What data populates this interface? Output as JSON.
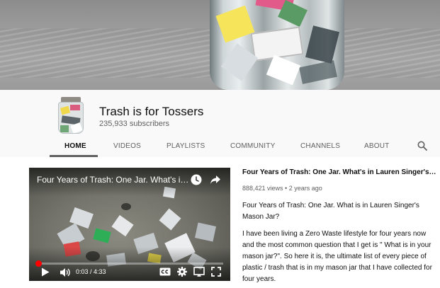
{
  "channel": {
    "name": "Trash is for Tossers",
    "subscribers": "235,933 subscribers"
  },
  "tabs": [
    {
      "label": "HOME",
      "active": true
    },
    {
      "label": "VIDEOS",
      "active": false
    },
    {
      "label": "PLAYLISTS",
      "active": false
    },
    {
      "label": "COMMUNITY",
      "active": false
    },
    {
      "label": "CHANNELS",
      "active": false
    },
    {
      "label": "ABOUT",
      "active": false
    }
  ],
  "player": {
    "title": "Four Years of Trash: One Jar. What's in Lauren Singer's Mason Jar?",
    "time": "0:03 / 4:33",
    "progress_fraction": 0.011
  },
  "video": {
    "title": "Four Years of Trash: One Jar. What's in Lauren Singer's Mason Jar?",
    "meta": "888,421 views • 2 years ago",
    "description": [
      "Four Years of Trash: One Jar. What is in Lauren Singer's Mason Jar?",
      "I have been living a Zero Waste lifestyle for four years now and the most common question that I get is \" What is in your mason jar?\". So here it is, the ultimate list of every piece of plastic / trash that is in my mason jar that I have collected for four years."
    ]
  },
  "icons": [
    "clock-icon",
    "share-icon",
    "play-icon",
    "volume-icon",
    "cc-icon",
    "settings-icon",
    "miniplayer-icon",
    "fullscreen-icon",
    "search-icon"
  ],
  "colors": {
    "accent": "#ff0000",
    "text_primary": "#0f0f0f",
    "text_secondary": "#606060",
    "header_bg": "#f9f9f9"
  }
}
